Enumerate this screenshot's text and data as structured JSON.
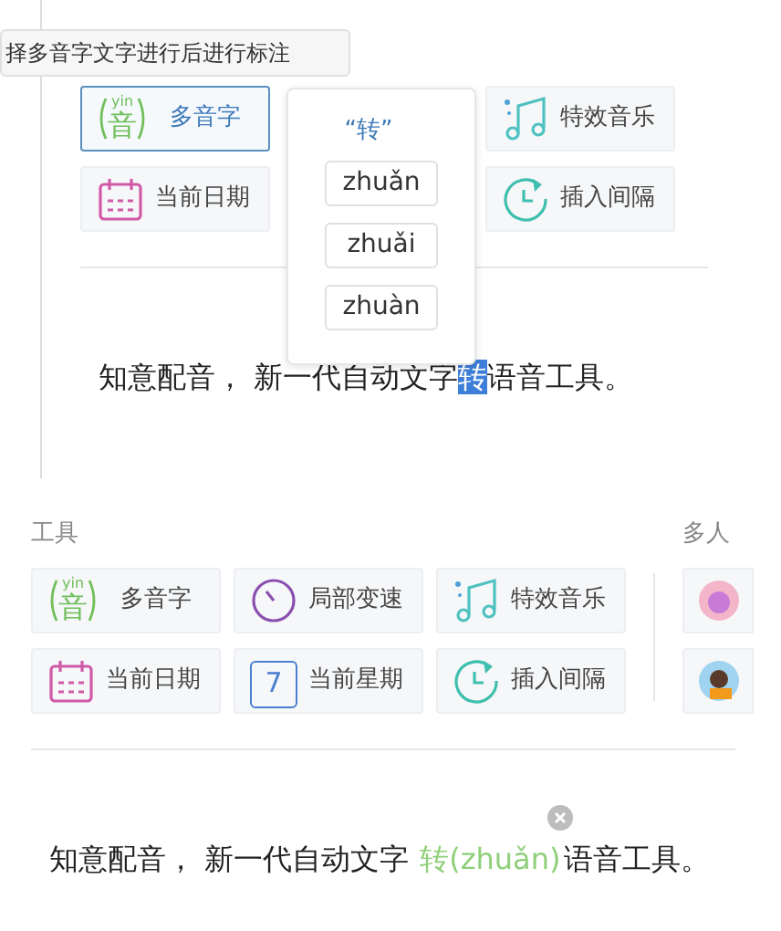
{
  "top_panel": {
    "tooltip": "择多音字文字进行后进行标注",
    "tools": [
      {
        "kind": "polyphone",
        "label": "多音字",
        "icon_pinyin": "yin",
        "icon_char": "音",
        "selected": true
      },
      {
        "kind": "music",
        "label": "特效音乐",
        "selected": false
      },
      {
        "kind": "date",
        "label": "当前日期",
        "selected": false
      },
      {
        "kind": "interval",
        "label": "插入间隔",
        "selected": false
      }
    ],
    "popup": {
      "title": "“转”",
      "options": [
        "zhuǎn",
        "zhuǎi",
        "zhuàn"
      ]
    },
    "editor_text": {
      "before": "知意配音， 新一代自动文字",
      "highlight": "转",
      "after": "语音工具。"
    }
  },
  "bottom_panel": {
    "section_title": "工具",
    "side_title": "多人",
    "tools": [
      {
        "kind": "polyphone",
        "label": "多音字",
        "icon_pinyin": "yin",
        "icon_char": "音",
        "selected": false
      },
      {
        "kind": "speed",
        "label": "局部变速",
        "selected": false
      },
      {
        "kind": "music",
        "label": "特效音乐",
        "selected": false
      },
      {
        "kind": "date",
        "label": "当前日期",
        "selected": false
      },
      {
        "kind": "weekday",
        "label": "当前星期",
        "icon_char": "7",
        "selected": false
      },
      {
        "kind": "interval",
        "label": "插入间隔",
        "selected": false
      }
    ],
    "editor_text": {
      "before": "知意配音， 新一代自动文字",
      "annotation": "转(zhuǎn)",
      "after": "语音工具。"
    }
  }
}
